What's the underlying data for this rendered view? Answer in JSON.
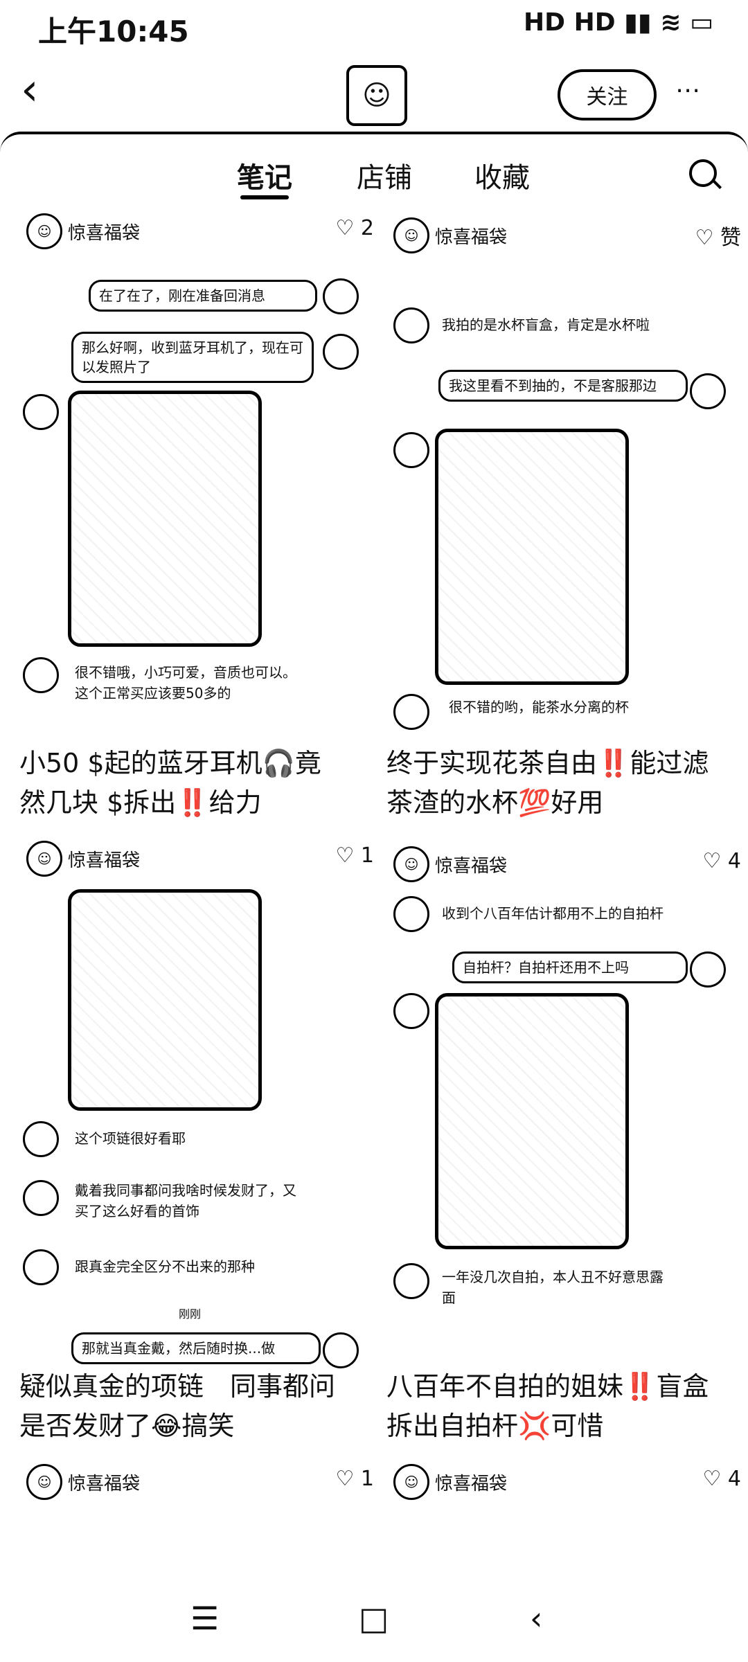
{
  "status": {
    "time": "上午10:45",
    "icons": "HD HD ▮▮ ≋ ▭"
  },
  "header": {
    "back_label": "‹",
    "follow_label": "关注",
    "more_label": "⋯"
  },
  "tabs": [
    {
      "label": "笔记"
    },
    {
      "label": "店铺"
    },
    {
      "label": "收藏"
    }
  ],
  "feed": {
    "left": {
      "top_row": {
        "author": "惊喜福袋",
        "likes": "2"
      },
      "card1": {
        "bubbles": [
          "在了在了，刚在准备回消息",
          "那么好啊，收到蓝牙耳机了，现在可以发照片了"
        ],
        "comment": "很不错哦，小巧可爱，音质也可以。这个正常买应该要50多的",
        "title": "小50 $起的蓝牙耳机🎧竟然几块 $拆出‼️给力",
        "author": "惊喜福袋",
        "likes": "1"
      },
      "card2": {
        "comments": [
          "这个项链很好看耶",
          "戴着我同事都问我啥时候发财了，又买了这么好看的首饰",
          "跟真金完全区分不出来的那种"
        ],
        "small": "刚刚",
        "bubble": "那就当真金戴，然后随时换...做",
        "title": "疑似真金的项链　同事都问是否发财了😂搞笑",
        "author": "惊喜福袋",
        "likes": "1"
      }
    },
    "right": {
      "top_row": {
        "author": "惊喜福袋",
        "likes": "赞"
      },
      "card1": {
        "comment1": "我拍的是水杯盲盒，肯定是水杯啦",
        "bubble": "我这里看不到抽的，不是客服那边",
        "comment2": "很不错的哟，能茶水分离的杯",
        "title": "终于实现花茶自由‼️能过滤茶渣的水杯💯好用",
        "author": "惊喜福袋",
        "likes": "4"
      },
      "card2": {
        "comment1": "收到个八百年估计都用不上的自拍杆",
        "bubble": "自拍杆？自拍杆还用不上吗",
        "comment2": "一年没几次自拍，本人丑不好意思露面",
        "title": "八百年不自拍的姐妹‼️盲盒拆出自拍杆💢可惜",
        "author": "惊喜福袋",
        "likes": "4"
      }
    }
  },
  "navbar": {
    "menu": "☰",
    "home": "□",
    "back": "‹"
  }
}
